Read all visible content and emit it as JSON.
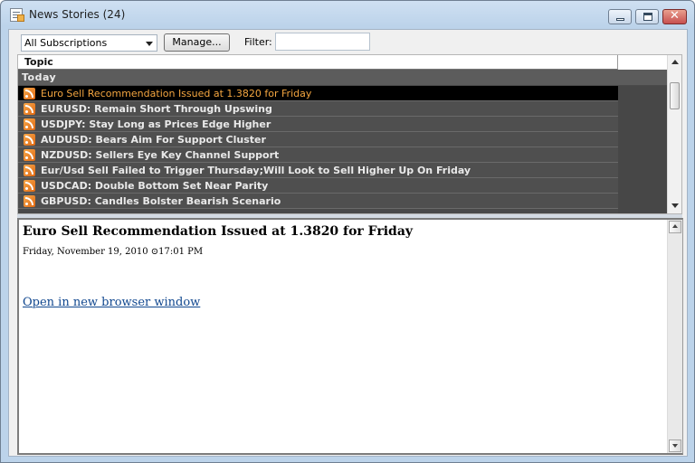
{
  "window": {
    "title": "News Stories (24)",
    "close_glyph": "✕"
  },
  "toolbar": {
    "subscription_selected": "All Subscriptions",
    "manage_label": "Manage...",
    "filter_label": "Filter:",
    "filter_value": ""
  },
  "list": {
    "column_header": "Topic",
    "group_label": "Today",
    "icon": "rss-icon",
    "rows": [
      {
        "label": "Euro Sell Recommendation Issued at 1.3820 for Friday"
      },
      {
        "label": "EURUSD: Remain Short Through Upswing"
      },
      {
        "label": "USDJPY: Stay Long as Prices Edge Higher"
      },
      {
        "label": "AUDUSD: Bears Aim For Support Cluster"
      },
      {
        "label": "NZDUSD: Sellers Eye Key Channel Support"
      },
      {
        "label": "Eur/Usd Sell Failed to Trigger Thursday;Will Look to Sell Higher Up On Friday"
      },
      {
        "label": "USDCAD: Double Bottom Set Near Parity"
      },
      {
        "label": "GBPUSD: Candles Bolster Bearish Scenario"
      }
    ]
  },
  "detail": {
    "title": "Euro Sell Recommendation Issued at 1.3820 for Friday",
    "date": "Friday, November 19, 2010 ⊙17:01 PM",
    "link_text": "Open in new browser window"
  },
  "colors": {
    "selected_text": "#f4a640",
    "list_bg": "#4f4f4f"
  }
}
